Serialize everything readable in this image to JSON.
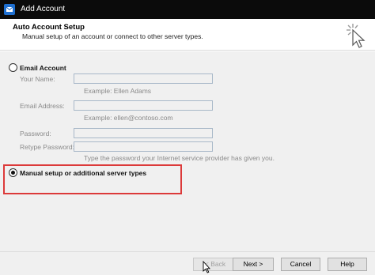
{
  "window": {
    "title": "Add Account"
  },
  "header": {
    "title": "Auto Account Setup",
    "subtitle": "Manual setup of an account or connect to other server types."
  },
  "options": {
    "email_account": {
      "label": "Email Account",
      "selected": false
    },
    "manual_setup": {
      "label": "Manual setup or additional server types",
      "selected": true
    }
  },
  "fields": {
    "your_name": {
      "label": "Your Name:",
      "value": "",
      "example": "Example: Ellen Adams"
    },
    "email_address": {
      "label": "Email Address:",
      "value": "",
      "example": "Example: ellen@contoso.com"
    },
    "password": {
      "label": "Password:",
      "value": ""
    },
    "retype_password": {
      "label": "Retype Password:",
      "value": "",
      "hint": "Type the password your Internet service provider has given you."
    }
  },
  "buttons": {
    "back": "< Back",
    "next": "Next >",
    "cancel": "Cancel",
    "help": "Help"
  },
  "colors": {
    "titlebar": "#0b0b0b",
    "highlight_box": "#dc3a3a",
    "dialog_bg": "#f0f0f0"
  }
}
